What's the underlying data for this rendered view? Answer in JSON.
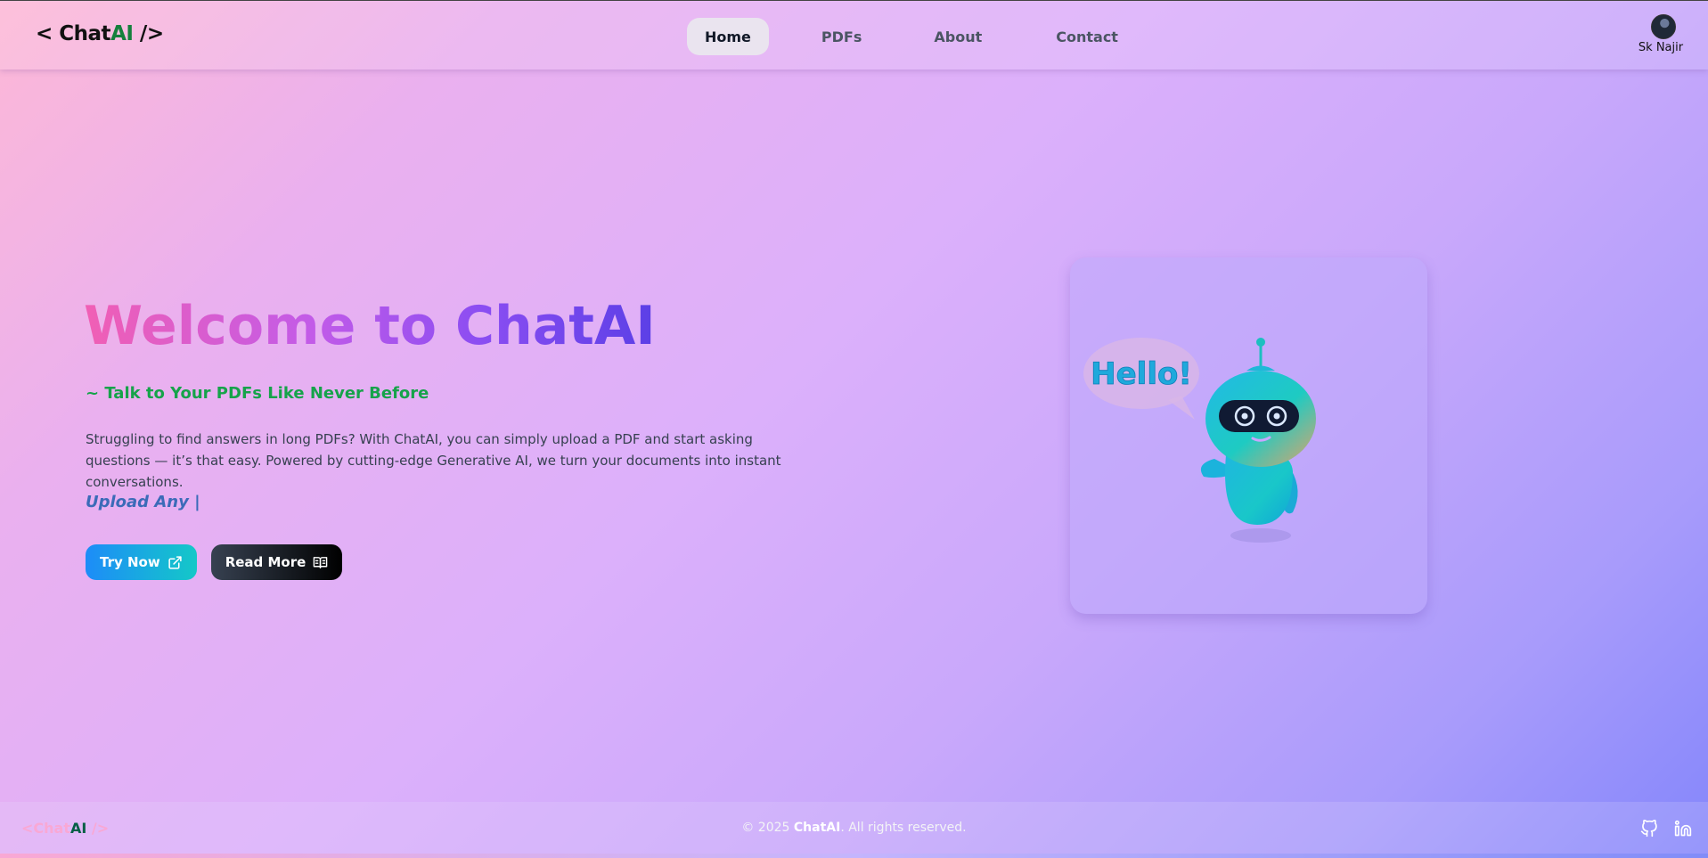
{
  "header": {
    "logo": {
      "prefix": "< Chat",
      "accent": "AI",
      "suffix": " />"
    },
    "nav": [
      {
        "label": "Home",
        "active": true
      },
      {
        "label": "PDFs",
        "active": false
      },
      {
        "label": "About",
        "active": false
      },
      {
        "label": "Contact",
        "active": false
      }
    ],
    "user": {
      "name": "Sk Najir",
      "avatar_icon": "user-avatar"
    }
  },
  "hero": {
    "title": "Welcome to ChatAI",
    "subtitle": "~ Talk to Your PDFs Like Never Before",
    "description": "Struggling to find answers in long PDFs? With ChatAI, you can simply upload a PDF and start asking questions — it’s that easy. Powered by cutting-edge Generative AI, we turn your documents into instant conversations.",
    "typewriter": "Upload Any |",
    "buttons": {
      "try_now": {
        "label": "Try Now",
        "icon": "external-link-icon"
      },
      "read_more": {
        "label": "Read More",
        "icon": "book-open-icon"
      }
    }
  },
  "illustration": {
    "speech_bubble": "Hello!",
    "description_icon": "robot-mascot"
  },
  "footer": {
    "logo": {
      "prefix": "<Chat",
      "accent": "AI",
      "suffix": " />"
    },
    "copyright_prefix": "© 2025 ",
    "copyright_brand": "ChatAI",
    "copyright_suffix": ". All rights reserved.",
    "social": [
      {
        "name": "github",
        "icon": "github-icon"
      },
      {
        "name": "linkedin",
        "icon": "linkedin-icon"
      }
    ]
  },
  "colors": {
    "accent_green": "#16a34a",
    "title_gradient_start": "#f15fb4",
    "title_gradient_end": "#5b3fe6",
    "try_now_gradient": [
      "#1d8cf8",
      "#14c8c8"
    ],
    "read_more_bg": "#000000"
  }
}
